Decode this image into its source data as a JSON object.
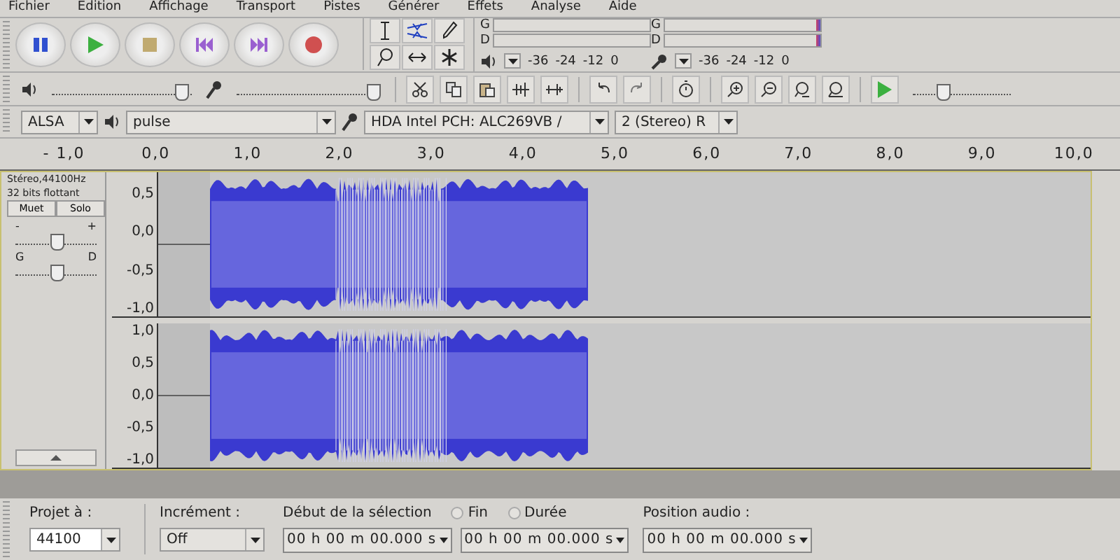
{
  "menu": [
    "Fichier",
    "Edition",
    "Affichage",
    "Transport",
    "Pistes",
    "Générer",
    "Effets",
    "Analyse",
    "Aide"
  ],
  "playback_meter": {
    "channels": [
      "G",
      "D"
    ],
    "scale": [
      "-36",
      "-24",
      "-12",
      "0"
    ]
  },
  "record_meter": {
    "channels": [
      "G",
      "D"
    ],
    "scale": [
      "-36",
      "-24",
      "-12",
      "0"
    ]
  },
  "mixer": {
    "output_volume": {
      "level": 0.92
    },
    "input_volume": {
      "level": 0.97
    }
  },
  "play_at_speed": {
    "level": 0.3
  },
  "devices": {
    "host": "ALSA",
    "output": "pulse",
    "input": "HDA Intel PCH: ALC269VB /",
    "channels": "2 (Stereo) R"
  },
  "ruler": [
    "- 1,0",
    "0,0",
    "1,0",
    "2,0",
    "3,0",
    "4,0",
    "5,0",
    "6,0",
    "7,0",
    "8,0",
    "9,0",
    "10,0"
  ],
  "track": {
    "info": [
      "Stéreo,44100Hz",
      "32 bits flottant"
    ],
    "mute": "Muet",
    "solo": "Solo",
    "gain": {
      "min": "-",
      "max": "+",
      "level": 0.5
    },
    "pan": {
      "left": "G",
      "right": "D",
      "level": 0.5
    },
    "channels": [
      {
        "scale": [
          "0,5",
          "0,0",
          "-0,5",
          "-1,0"
        ]
      },
      {
        "scale": [
          "1,0",
          "0,5",
          "0,0",
          "-0,5",
          "-1,0"
        ]
      }
    ]
  },
  "selection_bar": {
    "rate_label": "Projet à :",
    "rate": "44100",
    "snap_label": "Incrément :",
    "snap": "Off",
    "start_label": "Début de la sélection",
    "end_options": [
      {
        "label": "Fin",
        "selected": false
      },
      {
        "label": "Durée",
        "selected": false
      }
    ],
    "start": "00 h 00 m 00.000 s",
    "end": "00 h 00 m 00.000 s",
    "position_label": "Position audio :",
    "position": "00 h 00 m 00.000 s"
  }
}
